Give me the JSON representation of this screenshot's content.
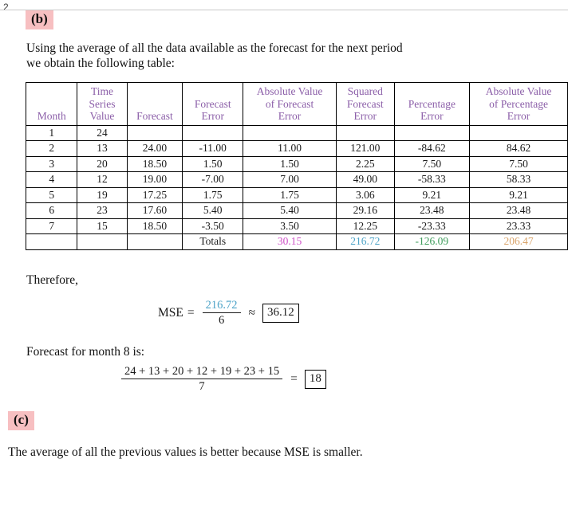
{
  "page": {
    "number": "2"
  },
  "parts": {
    "b_label": "(b)",
    "c_label": "(c)"
  },
  "intro": {
    "text": "Using the average of all the data available as the forecast for the next period\nwe obtain the following table:"
  },
  "table": {
    "headers": [
      {
        "lines": [
          "Month"
        ]
      },
      {
        "lines": [
          "Time",
          "Series",
          "Value"
        ]
      },
      {
        "lines": [
          "Forecast"
        ]
      },
      {
        "lines": [
          "Forecast",
          "Error"
        ]
      },
      {
        "lines": [
          "Absolute Value",
          "of Forecast",
          "Error"
        ]
      },
      {
        "lines": [
          "Squared",
          "Forecast",
          "Error"
        ]
      },
      {
        "lines": [
          "Percentage",
          "Error"
        ]
      },
      {
        "lines": [
          "Absolute Value",
          "of Percentage",
          "Error"
        ]
      }
    ],
    "rows": [
      {
        "month": "1",
        "value": "24",
        "forecast": "",
        "error": "",
        "abs_error": "",
        "sq_error": "",
        "pct_error": "",
        "abs_pct_error": ""
      },
      {
        "month": "2",
        "value": "13",
        "forecast": "24.00",
        "error": "-11.00",
        "abs_error": "11.00",
        "sq_error": "121.00",
        "pct_error": "-84.62",
        "abs_pct_error": "84.62"
      },
      {
        "month": "3",
        "value": "20",
        "forecast": "18.50",
        "error": "1.50",
        "abs_error": "1.50",
        "sq_error": "2.25",
        "pct_error": "7.50",
        "abs_pct_error": "7.50"
      },
      {
        "month": "4",
        "value": "12",
        "forecast": "19.00",
        "error": "-7.00",
        "abs_error": "7.00",
        "sq_error": "49.00",
        "pct_error": "-58.33",
        "abs_pct_error": "58.33"
      },
      {
        "month": "5",
        "value": "19",
        "forecast": "17.25",
        "error": "1.75",
        "abs_error": "1.75",
        "sq_error": "3.06",
        "pct_error": "9.21",
        "abs_pct_error": "9.21"
      },
      {
        "month": "6",
        "value": "23",
        "forecast": "17.60",
        "error": "5.40",
        "abs_error": "5.40",
        "sq_error": "29.16",
        "pct_error": "23.48",
        "abs_pct_error": "23.48"
      },
      {
        "month": "7",
        "value": "15",
        "forecast": "18.50",
        "error": "-3.50",
        "abs_error": "3.50",
        "sq_error": "12.25",
        "pct_error": "-23.33",
        "abs_pct_error": "23.33"
      }
    ],
    "totals": {
      "label": "Totals",
      "abs_error": "30.15",
      "sq_error": "216.72",
      "pct_error": "-126.09",
      "abs_pct_error": "206.47"
    }
  },
  "therefore": {
    "text": "Therefore,"
  },
  "mse": {
    "label": "MSE",
    "equals": "=",
    "numerator": "216.72",
    "denominator": "6",
    "approx": "≈",
    "result": "36.12"
  },
  "forecast_section": {
    "lead": "Forecast for month 8 is:",
    "numerator": "24 + 13 + 20 + 12 + 19 + 23 + 15",
    "denominator": "7",
    "equals": "=",
    "result": "18"
  },
  "conclusion": {
    "text": "The average of all the previous values is better because MSE is smaller."
  },
  "colors": {
    "header_purple": "#8b5ea8",
    "highlight_pink": "#f7bfc1",
    "total_mad": "#d050c8",
    "total_mse": "#4da3c7",
    "total_mpe": "#3f9d5c",
    "total_mape": "#d9a46a"
  }
}
